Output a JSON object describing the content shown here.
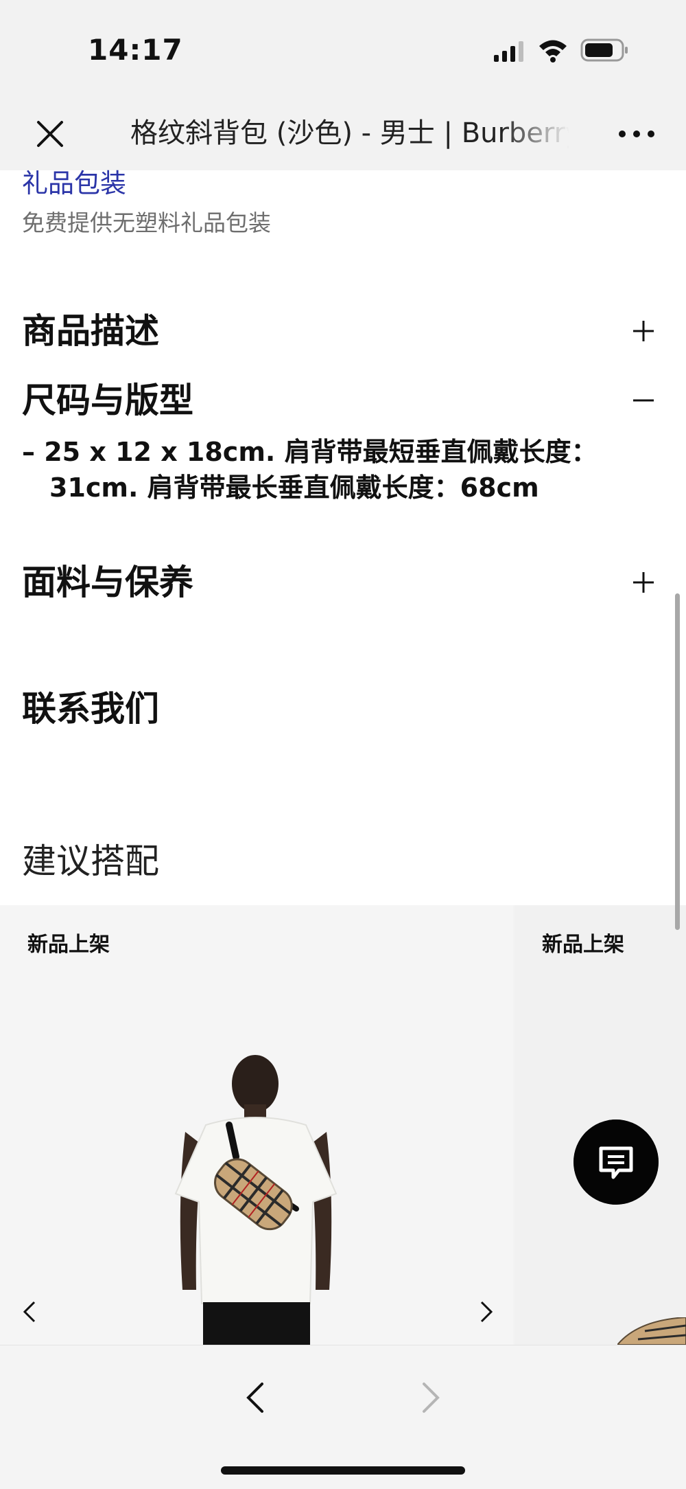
{
  "status_bar": {
    "time": "14:17",
    "icons": [
      "signal-icon",
      "wifi-icon",
      "battery-icon"
    ]
  },
  "header": {
    "title": "格纹斜背包 (沙色) - 男士 | Burberry",
    "close_icon": "close-icon",
    "more_icon": "more-icon"
  },
  "gift": {
    "link": "礼品包装",
    "description": "免费提供无塑料礼品包装"
  },
  "sections": {
    "description": {
      "heading": "商品描述",
      "toggle": "+"
    },
    "size_fit": {
      "heading": "尺码与版型",
      "toggle": "−",
      "line1": "– 25 x 12 x 18cm. 肩背带最短垂直佩戴长度：",
      "line2": "31cm. 肩背带最长垂直佩戴长度：68cm"
    },
    "material_care": {
      "heading": "面料与保养",
      "toggle": "+"
    },
    "contact": {
      "heading": "联系我们"
    }
  },
  "suggestions": {
    "heading": "建议搭配",
    "cards": [
      {
        "badge": "新品上架"
      },
      {
        "badge": "新品上架"
      }
    ]
  },
  "colors": {
    "link": "#2b35a8",
    "chat_button": "#050505",
    "header_bg": "#f2f2f2"
  },
  "bottom_nav": {
    "back_icon": "chevron-left-icon",
    "forward_icon": "chevron-right-icon"
  }
}
